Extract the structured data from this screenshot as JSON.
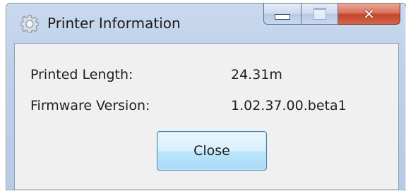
{
  "window": {
    "title": "Printer Information",
    "icon": "gear-icon",
    "caption_buttons": {
      "minimize": "minimize-icon",
      "maximize": "maximize-icon",
      "close": "close-icon",
      "close_color": "#c4452b"
    }
  },
  "info": {
    "printed_length_label": "Printed Length:",
    "printed_length_value": "24.31m",
    "firmware_label": "Firmware Version:",
    "firmware_value": "1.02.37.00.beta1"
  },
  "buttons": {
    "close_label": "Close"
  }
}
